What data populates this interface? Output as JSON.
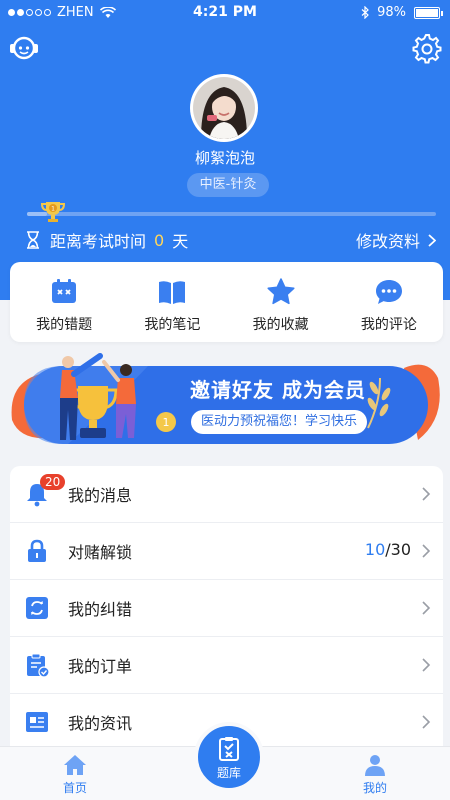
{
  "status_bar": {
    "carrier": "ZHEN",
    "time": "4:21 PM",
    "battery": "98%",
    "battery_level": 0.98
  },
  "profile": {
    "name": "柳絮泡泡",
    "subject_tag": "中医-针灸",
    "progress": 0.05
  },
  "exam": {
    "label": "距离考试时间",
    "days": "0",
    "unit": "天",
    "edit_label": "修改资料"
  },
  "shortcuts": [
    {
      "label": "我的错题",
      "icon": "wrong-questions-icon"
    },
    {
      "label": "我的笔记",
      "icon": "notes-book-icon"
    },
    {
      "label": "我的收藏",
      "icon": "star-icon"
    },
    {
      "label": "我的评论",
      "icon": "comment-icon"
    }
  ],
  "banner": {
    "title": "邀请好友 成为会员",
    "subtitle": "医动力预祝福您！学习快乐"
  },
  "menu": {
    "messages": {
      "label": "我的消息",
      "badge": "20",
      "icon": "bell-icon"
    },
    "unlock": {
      "label": "对赌解锁",
      "current": "10",
      "separator": "/",
      "total": "30",
      "icon": "lock-icon"
    },
    "corrections": {
      "label": "我的纠错",
      "icon": "correction-icon"
    },
    "orders": {
      "label": "我的订单",
      "icon": "order-clipboard-icon"
    },
    "news": {
      "label": "我的资讯",
      "icon": "news-icon"
    }
  },
  "tabbar": {
    "home": "首页",
    "question_bank": "题库",
    "mine": "我的"
  },
  "colors": {
    "brand": "#2f7df0",
    "accent_days": "#ffd75a",
    "badge": "#e8412c"
  }
}
